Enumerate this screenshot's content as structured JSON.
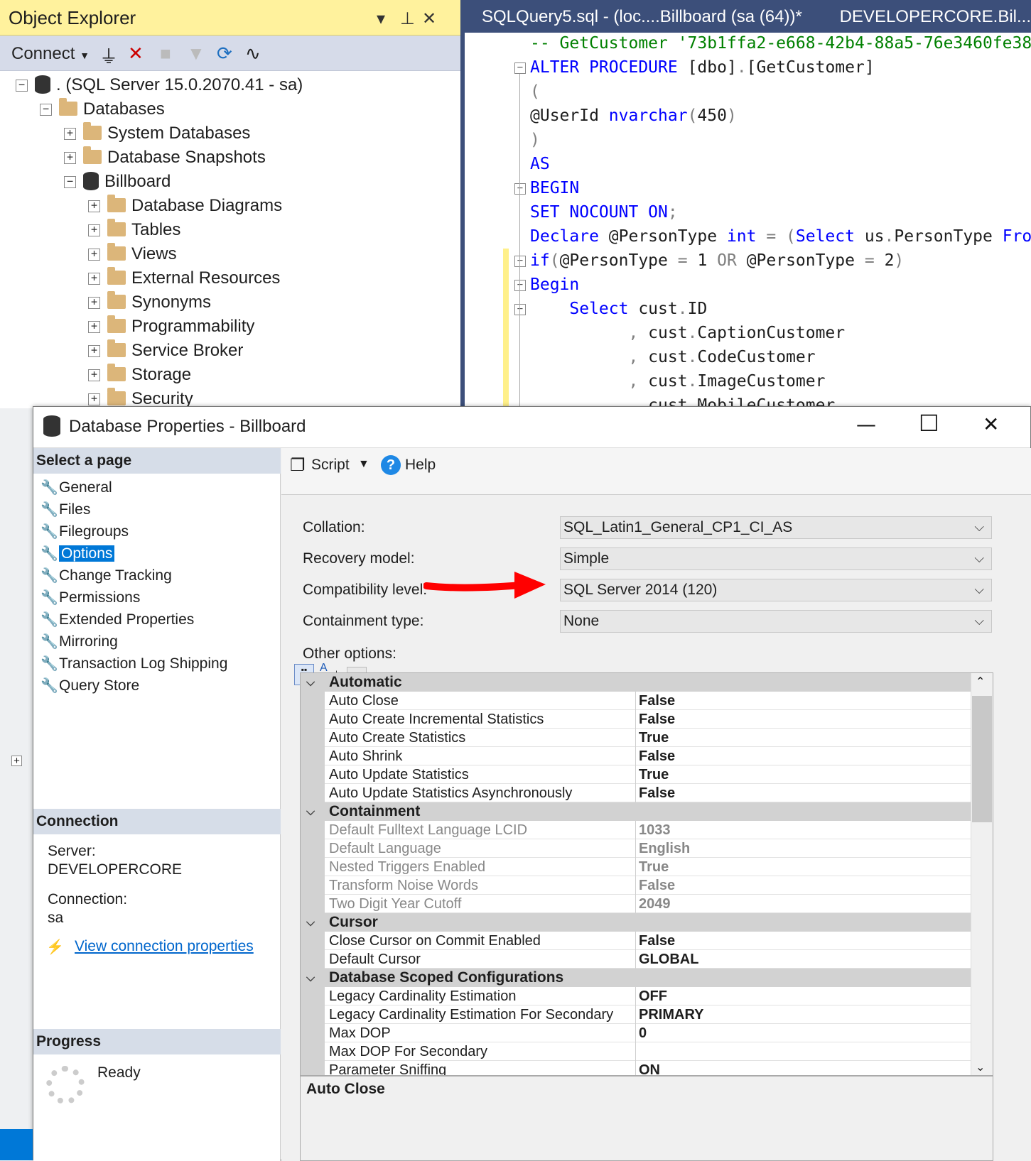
{
  "object_explorer": {
    "title": "Object Explorer",
    "connect_label": "Connect",
    "tree": [
      {
        "label": ". (SQL Server 15.0.2070.41 - sa)",
        "expander": "−",
        "icon": "server-icon"
      },
      {
        "label": "Databases",
        "expander": "−",
        "icon": "folder-icon"
      },
      {
        "label": "System Databases",
        "expander": "+",
        "icon": "folder-icon"
      },
      {
        "label": "Database Snapshots",
        "expander": "+",
        "icon": "folder-icon"
      },
      {
        "label": "Billboard",
        "expander": "−",
        "icon": "database-icon"
      },
      {
        "label": "Database Diagrams",
        "expander": "+",
        "icon": "folder-icon"
      },
      {
        "label": "Tables",
        "expander": "+",
        "icon": "folder-icon"
      },
      {
        "label": "Views",
        "expander": "+",
        "icon": "folder-icon"
      },
      {
        "label": "External Resources",
        "expander": "+",
        "icon": "folder-icon"
      },
      {
        "label": "Synonyms",
        "expander": "+",
        "icon": "folder-icon"
      },
      {
        "label": "Programmability",
        "expander": "+",
        "icon": "folder-icon"
      },
      {
        "label": "Service Broker",
        "expander": "+",
        "icon": "folder-icon"
      },
      {
        "label": "Storage",
        "expander": "+",
        "icon": "folder-icon"
      },
      {
        "label": "Security",
        "expander": "+",
        "icon": "folder-icon"
      }
    ]
  },
  "editor": {
    "tab_name": "SQLQuery5.sql - (loc....Billboard (sa (64))*",
    "tab_server": "DEVELOPERCORE.Bil...",
    "lines": [
      [
        {
          "t": "-- GetCustomer '73b1ffa2-e668-42b4-88a5-76e3460fe38",
          "c": "cm"
        }
      ],
      [
        {
          "t": "ALTER PROCEDURE",
          "c": "kw"
        },
        {
          "t": " [dbo]",
          "c": ""
        },
        {
          "t": ".",
          "c": "gr"
        },
        {
          "t": "[GetCustomer]",
          "c": ""
        }
      ],
      [
        {
          "t": "(",
          "c": "gr"
        }
      ],
      [
        {
          "t": "@UserId ",
          "c": ""
        },
        {
          "t": "nvarchar",
          "c": "kw"
        },
        {
          "t": "(",
          "c": "gr"
        },
        {
          "t": "450",
          "c": ""
        },
        {
          "t": ")",
          "c": "gr"
        }
      ],
      [
        {
          "t": ")",
          "c": "gr"
        }
      ],
      [
        {
          "t": "AS",
          "c": "kw"
        }
      ],
      [
        {
          "t": "BEGIN",
          "c": "kw"
        }
      ],
      [
        {
          "t": "SET NOCOUNT ON",
          "c": "kw"
        },
        {
          "t": ";",
          "c": "gr"
        }
      ],
      [
        {
          "t": "Declare",
          "c": "kw"
        },
        {
          "t": " @PersonType ",
          "c": ""
        },
        {
          "t": "int",
          "c": "kw"
        },
        {
          "t": " = (",
          "c": "gr"
        },
        {
          "t": "Select",
          "c": "kw"
        },
        {
          "t": " us",
          "c": ""
        },
        {
          "t": ".",
          "c": "gr"
        },
        {
          "t": "PersonType ",
          "c": ""
        },
        {
          "t": "Fro",
          "c": "kw"
        }
      ],
      [
        {
          "t": "if",
          "c": "kw"
        },
        {
          "t": "(",
          "c": "gr"
        },
        {
          "t": "@PersonType ",
          "c": ""
        },
        {
          "t": "= ",
          "c": "gr"
        },
        {
          "t": "1 ",
          "c": ""
        },
        {
          "t": "OR ",
          "c": "gr"
        },
        {
          "t": "@PersonType ",
          "c": ""
        },
        {
          "t": "= ",
          "c": "gr"
        },
        {
          "t": "2",
          "c": ""
        },
        {
          "t": ")",
          "c": "gr"
        }
      ],
      [
        {
          "t": "Begin",
          "c": "kw"
        }
      ],
      [
        {
          "t": "    ",
          "c": ""
        },
        {
          "t": "Select",
          "c": "kw"
        },
        {
          "t": " cust",
          "c": ""
        },
        {
          "t": ".",
          "c": "gr"
        },
        {
          "t": "ID",
          "c": ""
        }
      ],
      [
        {
          "t": "          , ",
          "c": "gr"
        },
        {
          "t": "cust",
          "c": ""
        },
        {
          "t": ".",
          "c": "gr"
        },
        {
          "t": "CaptionCustomer",
          "c": ""
        }
      ],
      [
        {
          "t": "          , ",
          "c": "gr"
        },
        {
          "t": "cust",
          "c": ""
        },
        {
          "t": ".",
          "c": "gr"
        },
        {
          "t": "CodeCustomer",
          "c": ""
        }
      ],
      [
        {
          "t": "          , ",
          "c": "gr"
        },
        {
          "t": "cust",
          "c": ""
        },
        {
          "t": ".",
          "c": "gr"
        },
        {
          "t": "ImageCustomer",
          "c": ""
        }
      ],
      [
        {
          "t": "          , ",
          "c": "gr"
        },
        {
          "t": "cust",
          "c": ""
        },
        {
          "t": ".",
          "c": "gr"
        },
        {
          "t": "MobileCustomer",
          "c": ""
        }
      ]
    ]
  },
  "dialog": {
    "title": "Database Properties - Billboard",
    "select_page_header": "Select a page",
    "pages": [
      "General",
      "Files",
      "Filegroups",
      "Options",
      "Change Tracking",
      "Permissions",
      "Extended Properties",
      "Mirroring",
      "Transaction Log Shipping",
      "Query Store"
    ],
    "selected_page": "Options",
    "connection_header": "Connection",
    "server_label": "Server:",
    "server_value": "DEVELOPERCORE",
    "connection_label": "Connection:",
    "connection_value": "sa",
    "view_connection_link": "View connection properties",
    "progress_header": "Progress",
    "progress_status": "Ready",
    "toolbar": {
      "script_label": "Script",
      "help_label": "Help"
    },
    "fields": {
      "collation_label": "Collation:",
      "collation_value": "SQL_Latin1_General_CP1_CI_AS",
      "recovery_label": "Recovery model:",
      "recovery_value": "Simple",
      "compat_label": "Compatibility level:",
      "compat_value": "SQL Server 2014 (120)",
      "containment_label": "Containment type:",
      "containment_value": "None",
      "other_options_label": "Other options:"
    },
    "grid": [
      {
        "category": "Automatic"
      },
      {
        "name": "Auto Close",
        "value": "False"
      },
      {
        "name": "Auto Create Incremental Statistics",
        "value": "False"
      },
      {
        "name": "Auto Create Statistics",
        "value": "True"
      },
      {
        "name": "Auto Shrink",
        "value": "False"
      },
      {
        "name": "Auto Update Statistics",
        "value": "True"
      },
      {
        "name": "Auto Update Statistics Asynchronously",
        "value": "False"
      },
      {
        "category": "Containment"
      },
      {
        "name": "Default Fulltext Language LCID",
        "value": "1033",
        "dim": true
      },
      {
        "name": "Default Language",
        "value": "English",
        "dim": true
      },
      {
        "name": "Nested Triggers Enabled",
        "value": "True",
        "dim": true
      },
      {
        "name": "Transform Noise Words",
        "value": "False",
        "dim": true
      },
      {
        "name": "Two Digit Year Cutoff",
        "value": "2049",
        "dim": true
      },
      {
        "category": "Cursor"
      },
      {
        "name": "Close Cursor on Commit Enabled",
        "value": "False"
      },
      {
        "name": "Default Cursor",
        "value": "GLOBAL"
      },
      {
        "category": "Database Scoped Configurations"
      },
      {
        "name": "Legacy Cardinality Estimation",
        "value": "OFF"
      },
      {
        "name": "Legacy Cardinality Estimation For Secondary",
        "value": "PRIMARY"
      },
      {
        "name": "Max DOP",
        "value": "0"
      },
      {
        "name": "Max DOP For Secondary",
        "value": ""
      },
      {
        "name": "Parameter Sniffing",
        "value": "ON"
      }
    ],
    "description_title": "Auto Close"
  },
  "colors": {
    "accent": "#0078d7",
    "annotation_arrow": "#ff0000",
    "oe_title": "#fff29d",
    "tab_bar": "#3c4f7a"
  }
}
